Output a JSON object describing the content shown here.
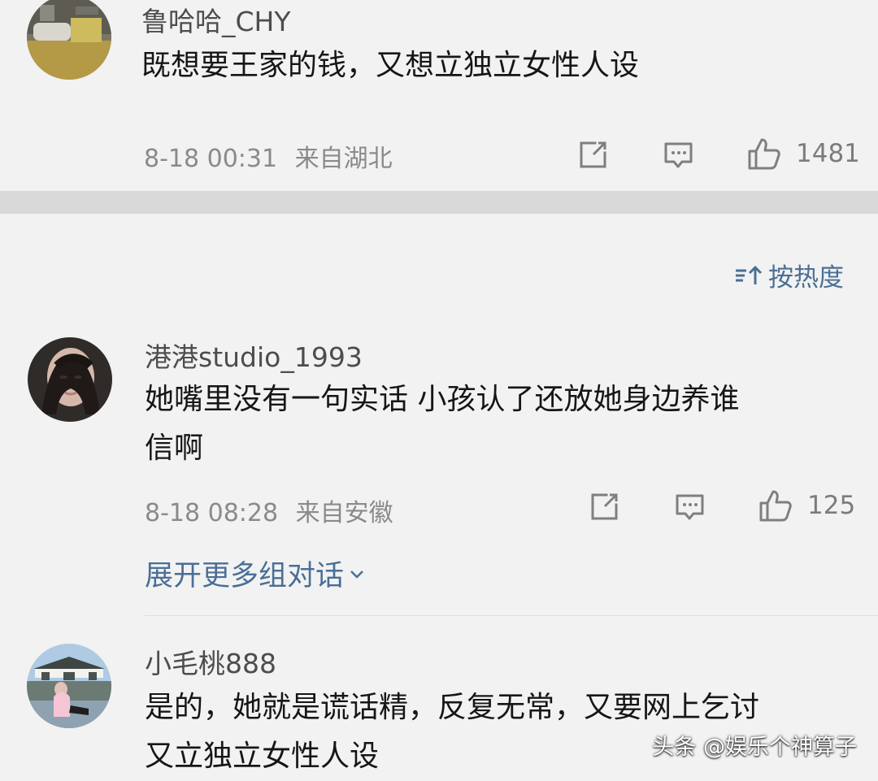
{
  "comments": [
    {
      "username": "鲁哈哈_CHY",
      "text_lines": [
        "既想要王家的钱，又想立独立女性人设"
      ],
      "date": "8-18 00:31",
      "location": "来自湖北",
      "likes": "1481"
    },
    {
      "username": "港港studio_1993",
      "text_lines": [
        "她嘴里没有一句实话 小孩认了还放她身边养谁",
        "信啊"
      ],
      "date": "8-18 08:28",
      "location": "来自安徽",
      "likes": "125"
    },
    {
      "username": "小毛桃888",
      "text_lines": [
        "是的，她就是谎话精，反复无常，又要网上乞讨",
        "又立独立女性人设"
      ]
    }
  ],
  "sort": {
    "label": "按热度",
    "icon": "sort-icon"
  },
  "expand": {
    "label": "展开更多组对话",
    "icon": "chevron-down-icon"
  },
  "watermark": "头条 @娱乐个神算子",
  "icons": {
    "repost": "repost-icon",
    "comment": "comment-icon",
    "like": "like-icon"
  },
  "colors": {
    "background": "#f2f2f2",
    "link_blue": "#4a6f96",
    "divider": "#d9d9d9"
  }
}
